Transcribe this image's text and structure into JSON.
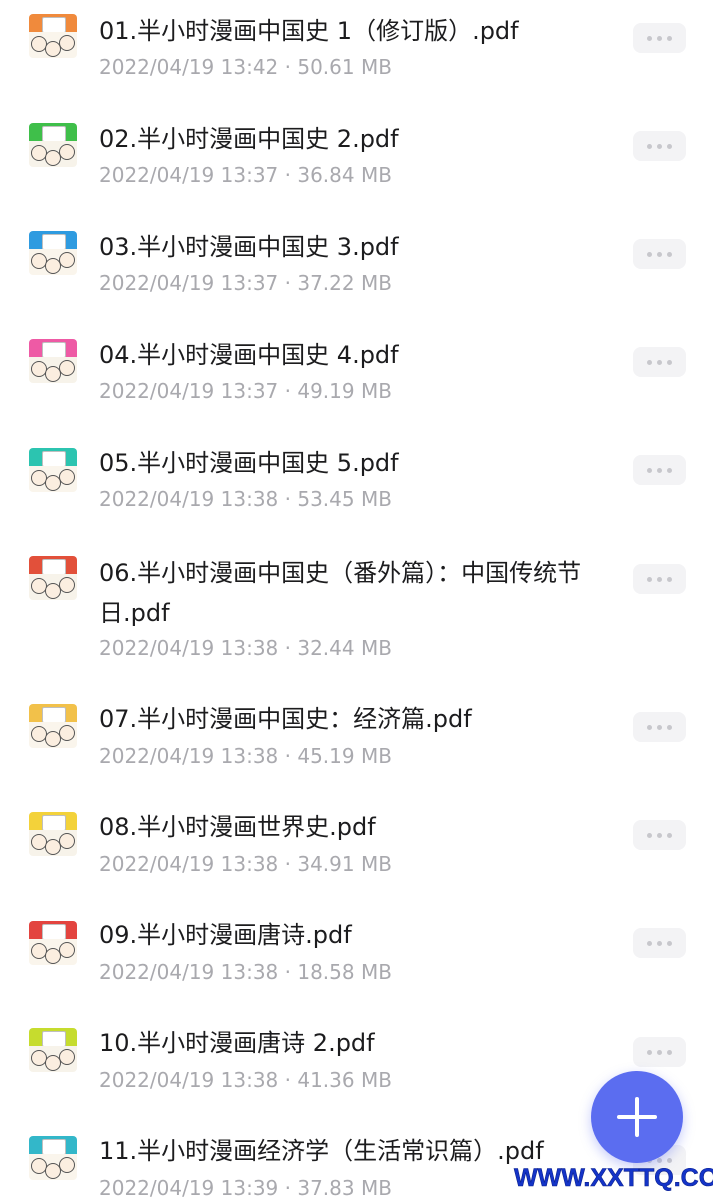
{
  "files": [
    {
      "name": "01.半小时漫画中国史 1（修订版）.pdf",
      "date": "2022/04/19 13:42",
      "size": "50.61 MB",
      "cover_color": "#f08a3c"
    },
    {
      "name": "02.半小时漫画中国史 2.pdf",
      "date": "2022/04/19 13:37",
      "size": "36.84 MB",
      "cover_color": "#3fbf4a"
    },
    {
      "name": "03.半小时漫画中国史 3.pdf",
      "date": "2022/04/19 13:37",
      "size": "37.22 MB",
      "cover_color": "#2f9be0"
    },
    {
      "name": "04.半小时漫画中国史 4.pdf",
      "date": "2022/04/19 13:37",
      "size": "49.19 MB",
      "cover_color": "#ee5aa5"
    },
    {
      "name": "05.半小时漫画中国史 5.pdf",
      "date": "2022/04/19 13:38",
      "size": "53.45 MB",
      "cover_color": "#2cc4b0"
    },
    {
      "name": "06.半小时漫画中国史（番外篇）：中国传统节日.pdf",
      "date": "2022/04/19 13:38",
      "size": "32.44 MB",
      "cover_color": "#e2503a"
    },
    {
      "name": "07.半小时漫画中国史：经济篇.pdf",
      "date": "2022/04/19 13:38",
      "size": "45.19 MB",
      "cover_color": "#f2c14a"
    },
    {
      "name": "08.半小时漫画世界史.pdf",
      "date": "2022/04/19 13:38",
      "size": "34.91 MB",
      "cover_color": "#f3d23a"
    },
    {
      "name": "09.半小时漫画唐诗.pdf",
      "date": "2022/04/19 13:38",
      "size": "18.58 MB",
      "cover_color": "#e3443f"
    },
    {
      "name": "10.半小时漫画唐诗 2.pdf",
      "date": "2022/04/19 13:38",
      "size": "41.36 MB",
      "cover_color": "#c6dc2e"
    },
    {
      "name": "11.半小时漫画经济学（生活常识篇）.pdf",
      "date": "2022/04/19 13:39",
      "size": "37.83 MB",
      "cover_color": "#33b7c9"
    }
  ],
  "meta_separator": " · ",
  "fab": {
    "icon": "plus-icon",
    "color": "#5b6df0"
  },
  "watermark": "WWW.XXTTQ.COM"
}
